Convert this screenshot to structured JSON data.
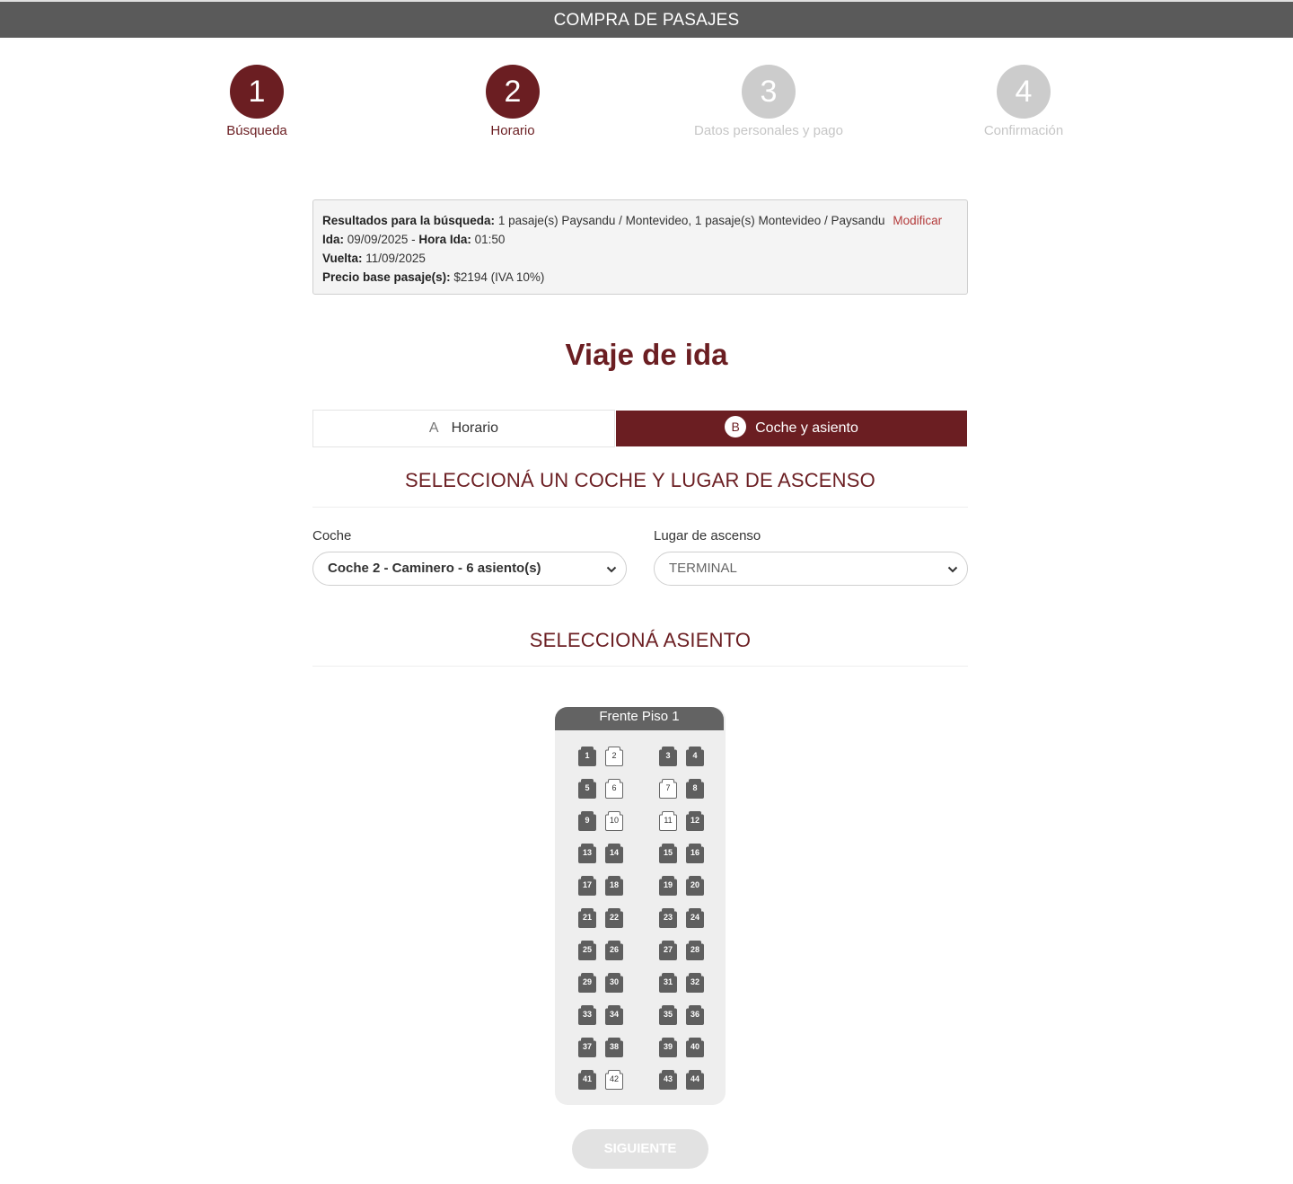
{
  "header": {
    "title": "COMPRA DE PASAJES"
  },
  "steps": [
    {
      "number": "1",
      "label": "Búsqueda"
    },
    {
      "number": "2",
      "label": "Horario"
    },
    {
      "number": "3",
      "label": "Datos personales y pago"
    },
    {
      "number": "4",
      "label": "Confirmación"
    }
  ],
  "summary": {
    "results_label": "Resultados para la búsqueda:",
    "results_value": "1 pasaje(s) Paysandu / Montevideo, 1 pasaje(s) Montevideo / Paysandu",
    "modify_link": "Modificar",
    "ida_label": "Ida:",
    "ida_value": "09/09/2025 -",
    "hora_ida_label": "Hora Ida:",
    "hora_ida_value": "01:50",
    "vuelta_label": "Vuelta:",
    "vuelta_value": "11/09/2025",
    "precio_label": "Precio base pasaje(s):",
    "precio_value": "$2194 (IVA 10%)"
  },
  "trip_title": "Viaje de ida",
  "tabs": {
    "a_letter": "A",
    "a_label": "Horario",
    "b_letter": "B",
    "b_label": "Coche y asiento"
  },
  "coach_section_title": "SELECCIONÁ UN COCHE Y LUGAR DE ASCENSO",
  "coche": {
    "label": "Coche",
    "value": "Coche 2 - Caminero - 6 asiento(s)"
  },
  "lugar": {
    "label": "Lugar de ascenso",
    "value": "TERMINAL"
  },
  "seat_section_title": "SELECCIONÁ ASIENTO",
  "bus": {
    "header": "Frente Piso 1",
    "seats": [
      {
        "n": "1",
        "free": false
      },
      {
        "n": "2",
        "free": true
      },
      {
        "n": "3",
        "free": false
      },
      {
        "n": "4",
        "free": false
      },
      {
        "n": "5",
        "free": false
      },
      {
        "n": "6",
        "free": true
      },
      {
        "n": "7",
        "free": true
      },
      {
        "n": "8",
        "free": false
      },
      {
        "n": "9",
        "free": false
      },
      {
        "n": "10",
        "free": true
      },
      {
        "n": "11",
        "free": true
      },
      {
        "n": "12",
        "free": false
      },
      {
        "n": "13",
        "free": false
      },
      {
        "n": "14",
        "free": false
      },
      {
        "n": "15",
        "free": false
      },
      {
        "n": "16",
        "free": false
      },
      {
        "n": "17",
        "free": false
      },
      {
        "n": "18",
        "free": false
      },
      {
        "n": "19",
        "free": false
      },
      {
        "n": "20",
        "free": false
      },
      {
        "n": "21",
        "free": false
      },
      {
        "n": "22",
        "free": false
      },
      {
        "n": "23",
        "free": false
      },
      {
        "n": "24",
        "free": false
      },
      {
        "n": "25",
        "free": false
      },
      {
        "n": "26",
        "free": false
      },
      {
        "n": "27",
        "free": false
      },
      {
        "n": "28",
        "free": false
      },
      {
        "n": "29",
        "free": false
      },
      {
        "n": "30",
        "free": false
      },
      {
        "n": "31",
        "free": false
      },
      {
        "n": "32",
        "free": false
      },
      {
        "n": "33",
        "free": false
      },
      {
        "n": "34",
        "free": false
      },
      {
        "n": "35",
        "free": false
      },
      {
        "n": "36",
        "free": false
      },
      {
        "n": "37",
        "free": false
      },
      {
        "n": "38",
        "free": false
      },
      {
        "n": "39",
        "free": false
      },
      {
        "n": "40",
        "free": false
      },
      {
        "n": "41",
        "free": false
      },
      {
        "n": "42",
        "free": true
      },
      {
        "n": "43",
        "free": false
      },
      {
        "n": "44",
        "free": false
      }
    ]
  },
  "next_button": "SIGUIENTE",
  "colors": {
    "brand": "#6b1e22",
    "occupied_seat": "#5f5f5f",
    "free_seat": "#ffffff"
  }
}
